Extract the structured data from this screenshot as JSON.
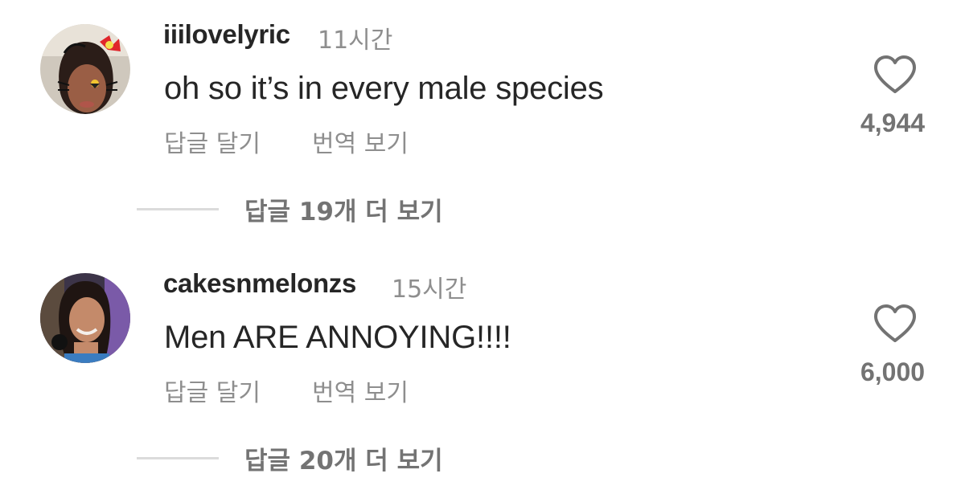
{
  "comments": [
    {
      "username": "iiilovelyric",
      "time": "11시간",
      "text": "oh so it’s in every male species",
      "reply_label": "답글 달기",
      "translate_label": "번역 보기",
      "like_count": "4,944",
      "more_replies": "답글 19개 더 보기"
    },
    {
      "username": "cakesnmelonzs",
      "time": "15시간",
      "text": "Men ARE ANNOYING!!!!",
      "reply_label": "답글 달기",
      "translate_label": "번역 보기",
      "like_count": "6,000",
      "more_replies": "답글 20개 더 보기"
    }
  ],
  "icons": {
    "like": "heart-outline-icon"
  },
  "colors": {
    "primary_text": "#262626",
    "secondary_text": "#8e8e8e",
    "count_text": "#737373",
    "divider": "#dbdbdb"
  }
}
